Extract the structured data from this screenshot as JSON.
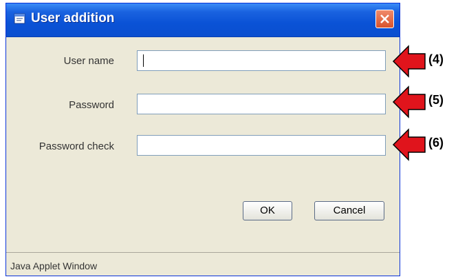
{
  "window": {
    "title": "User addition"
  },
  "form": {
    "user_name_label": "User name",
    "password_label": "Password",
    "password_check_label": "Password check"
  },
  "buttons": {
    "ok_label": "OK",
    "cancel_label": "Cancel"
  },
  "status_bar": {
    "text": "Java Applet Window"
  },
  "callouts": [
    "(4)",
    "(5)",
    "(6)"
  ],
  "colors": {
    "titlebar": "#0a52d6",
    "window_bg": "#ece9d8",
    "arrow": "#e0141c",
    "close": "#d9532c"
  }
}
